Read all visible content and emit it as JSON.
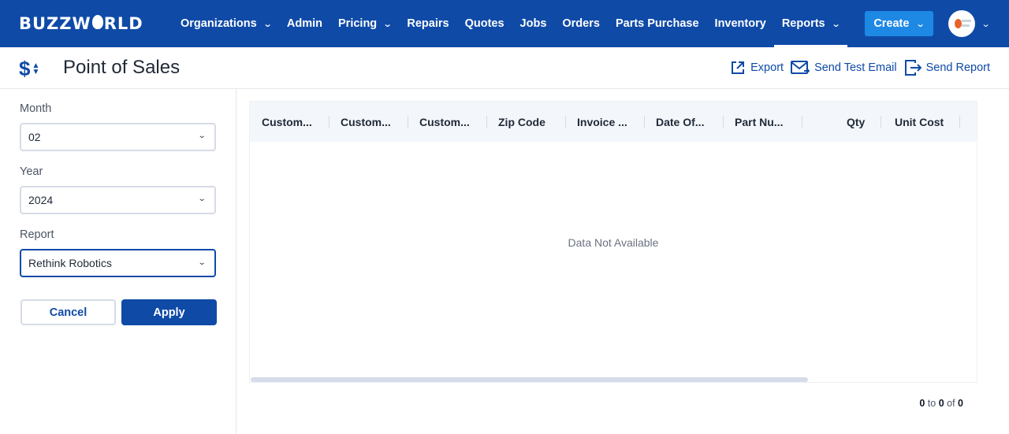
{
  "app": {
    "logo_text": "BUZZWORLD"
  },
  "nav": {
    "items": [
      {
        "label": "Organizations",
        "has_menu": true
      },
      {
        "label": "Admin",
        "has_menu": false
      },
      {
        "label": "Pricing",
        "has_menu": true
      },
      {
        "label": "Repairs",
        "has_menu": false
      },
      {
        "label": "Quotes",
        "has_menu": false
      },
      {
        "label": "Jobs",
        "has_menu": false
      },
      {
        "label": "Orders",
        "has_menu": false
      },
      {
        "label": "Parts Purchase",
        "has_menu": false
      },
      {
        "label": "Inventory",
        "has_menu": false
      },
      {
        "label": "Reports",
        "has_menu": true,
        "active": true
      }
    ],
    "create_label": "Create"
  },
  "page": {
    "title": "Point of Sales",
    "title_icon": "dollar-sort-icon",
    "actions": {
      "export": "Export",
      "send_test_email": "Send Test Email",
      "send_report": "Send Report"
    }
  },
  "filters": {
    "month": {
      "label": "Month",
      "value": "02"
    },
    "year": {
      "label": "Year",
      "value": "2024"
    },
    "report": {
      "label": "Report",
      "value": "Rethink Robotics"
    },
    "cancel_label": "Cancel",
    "apply_label": "Apply"
  },
  "grid": {
    "columns": [
      "Custom...",
      "Custom...",
      "Custom...",
      "Zip Code",
      "Invoice ...",
      "Date Of...",
      "Part Nu...",
      "Qty",
      "Unit Cost"
    ],
    "rows": [],
    "empty_message": "Data Not Available"
  },
  "pagination": {
    "from": "0",
    "to_word": "to",
    "to": "0",
    "of_word": "of",
    "total": "0"
  },
  "colors": {
    "primary": "#0f4aa7",
    "create_button": "#1e88e5",
    "header_bg": "#f3f6fb"
  }
}
